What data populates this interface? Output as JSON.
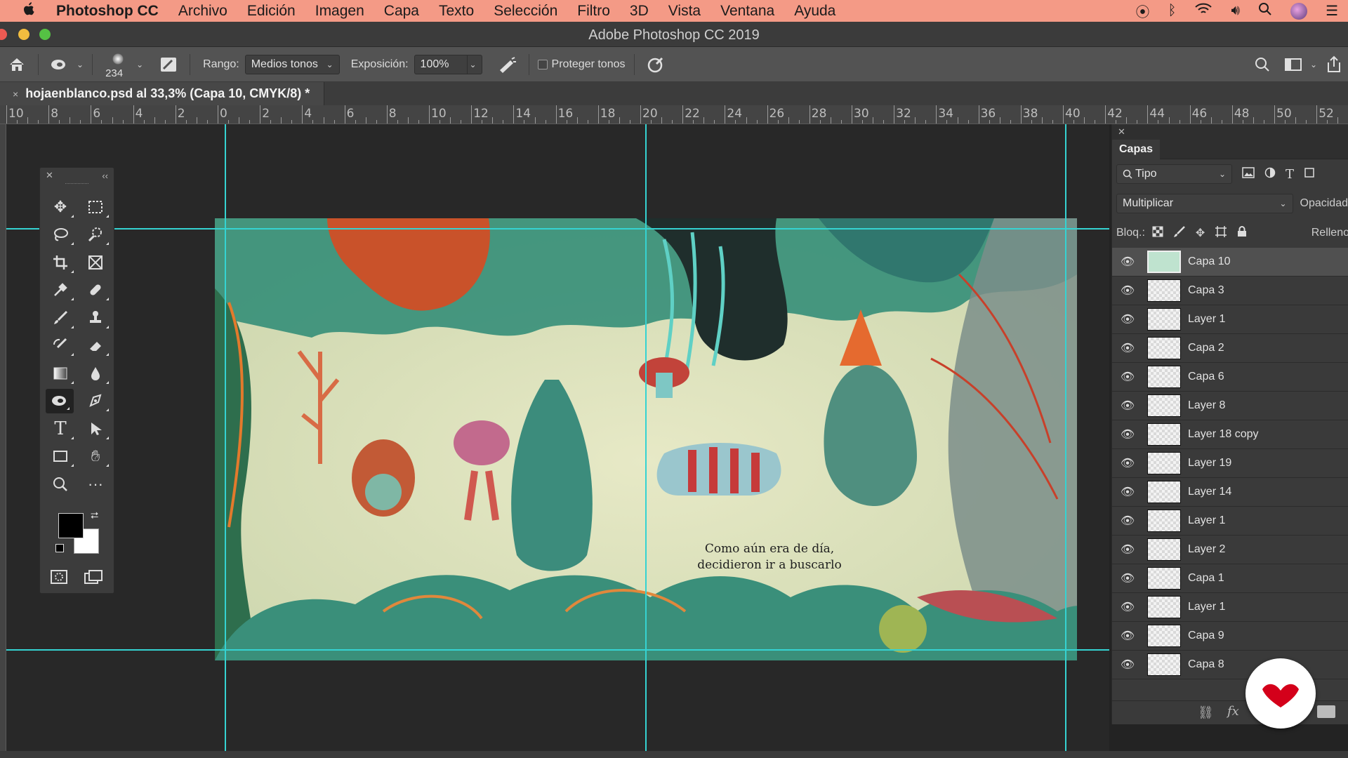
{
  "menubar": {
    "apple": "",
    "app": "Photoshop CC",
    "items": [
      "Archivo",
      "Edición",
      "Imagen",
      "Capa",
      "Texto",
      "Selección",
      "Filtro",
      "3D",
      "Vista",
      "Ventana",
      "Ayuda"
    ]
  },
  "window": {
    "title": "Adobe Photoshop CC 2019"
  },
  "options": {
    "brush_size": "234",
    "range_label": "Rango:",
    "range_value": "Medios tonos",
    "exposure_label": "Exposición:",
    "exposure_value": "100%",
    "protect_label": "Proteger tonos"
  },
  "document": {
    "tab": "hojaenblanco.psd al 33,3% (Capa 10, CMYK/8) *",
    "caption_line1": "Como aún era de día,",
    "caption_line2": "decidieron ir a buscarlo"
  },
  "ruler": {
    "labels": [
      "10",
      "8",
      "6",
      "4",
      "2",
      "0",
      "2",
      "4",
      "6",
      "8",
      "10",
      "12",
      "14",
      "16",
      "18",
      "20",
      "22",
      "24",
      "26",
      "28",
      "30",
      "32",
      "34",
      "36",
      "38",
      "40",
      "42",
      "44",
      "46",
      "48",
      "50",
      "52"
    ]
  },
  "layers_panel": {
    "tab": "Capas",
    "filter_value": "Tipo",
    "blend_mode": "Multiplicar",
    "opacity_label": "Opacidad",
    "lock_label": "Bloq.:",
    "fill_label": "Relleno",
    "layers": [
      {
        "name": "Capa 10",
        "selected": true
      },
      {
        "name": "Capa 3"
      },
      {
        "name": "Layer 1"
      },
      {
        "name": "Capa 2"
      },
      {
        "name": "Capa 6"
      },
      {
        "name": "Layer 8"
      },
      {
        "name": "Layer 18 copy"
      },
      {
        "name": "Layer 19"
      },
      {
        "name": "Layer 14"
      },
      {
        "name": "Layer 1"
      },
      {
        "name": "Layer 2"
      },
      {
        "name": "Capa 1"
      },
      {
        "name": "Layer 1"
      },
      {
        "name": "Capa 9"
      },
      {
        "name": "Capa 8"
      }
    ],
    "footer_fx": "fx"
  },
  "colors": {
    "menubar": "#f49a86",
    "guide": "#35d3d2",
    "foreground": "#000000",
    "background": "#ffffff",
    "badge": "#d4001a"
  }
}
